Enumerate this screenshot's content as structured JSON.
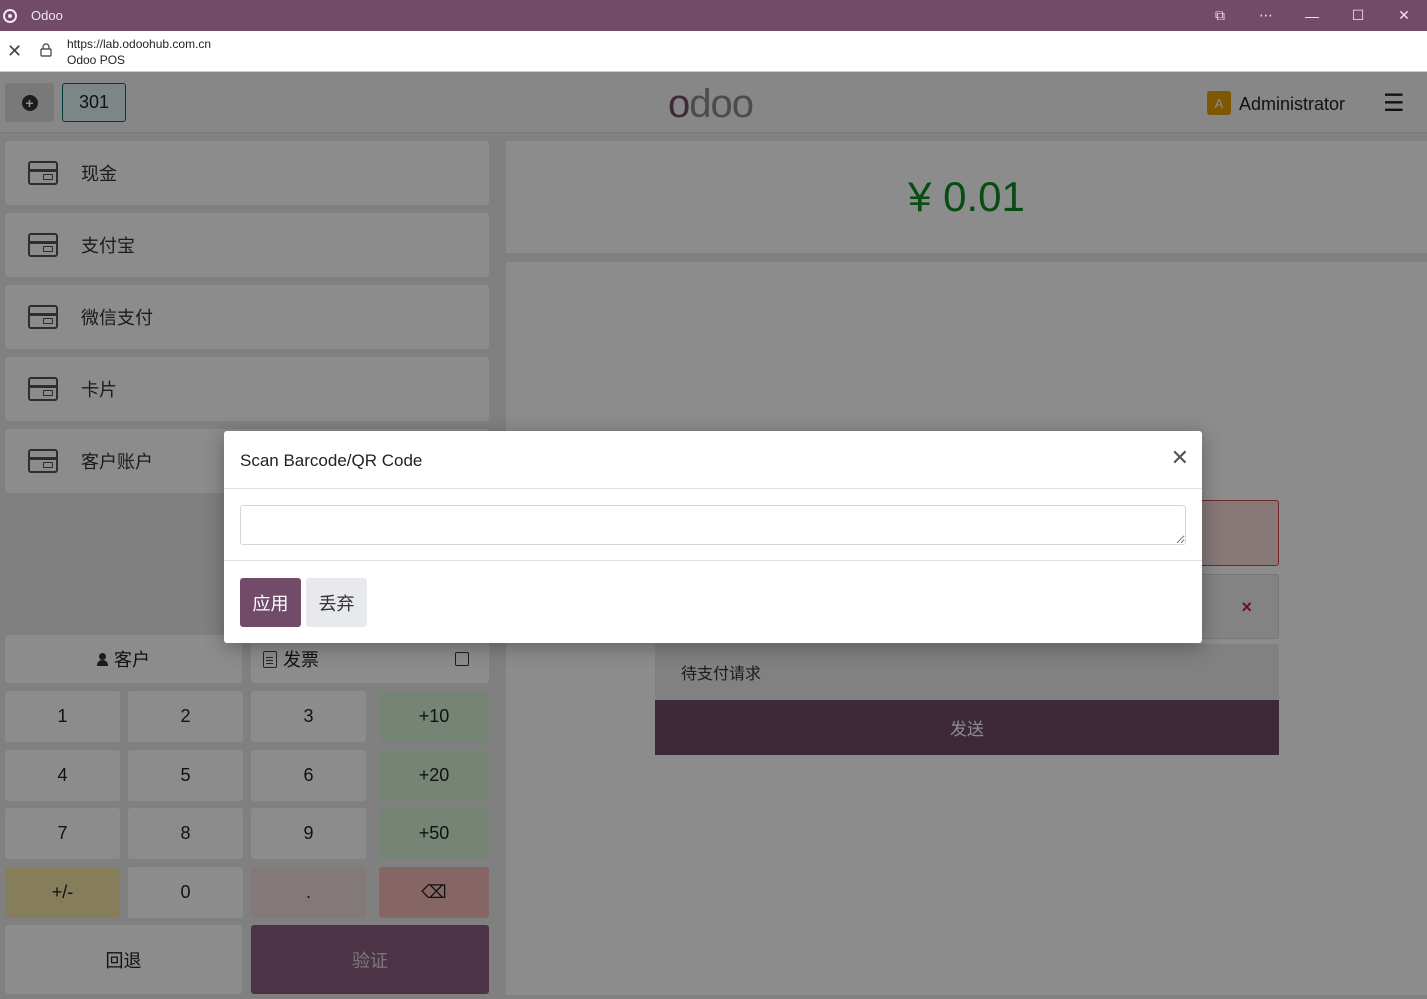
{
  "window": {
    "title": "Odoo"
  },
  "address": {
    "url": "https://lab.odoohub.com.cn",
    "page_title": "Odoo POS"
  },
  "header": {
    "order_number": "301",
    "logo_text": "odoo",
    "user_initial": "A",
    "user_name": "Administrator"
  },
  "payment_methods": [
    {
      "label": "现金",
      "icon": "cash-icon"
    },
    {
      "label": "支付宝",
      "icon": "card-icon"
    },
    {
      "label": "微信支付",
      "icon": "card-icon"
    },
    {
      "label": "卡片",
      "icon": "card-icon"
    },
    {
      "label": "客户账户",
      "icon": "customer-account-icon"
    }
  ],
  "summary": {
    "amount": "¥ 0.01"
  },
  "payment_panel": {
    "pending_label": "待支付请求",
    "send_label": "发送",
    "remove_symbol": "×"
  },
  "actions": {
    "customer_label": "客户",
    "invoice_label": "发票"
  },
  "numpad": {
    "keys": [
      "1",
      "2",
      "3",
      "+10",
      "4",
      "5",
      "6",
      "+20",
      "7",
      "8",
      "9",
      "+50",
      "+/-",
      "0",
      ".",
      "⌫"
    ],
    "back_label": "回退",
    "validate_label": "验证"
  },
  "modal": {
    "title": "Scan Barcode/QR Code",
    "input_value": "",
    "apply_label": "应用",
    "discard_label": "丢弃"
  },
  "colors": {
    "brand": "#714b67",
    "amount": "#0d8a1f"
  }
}
